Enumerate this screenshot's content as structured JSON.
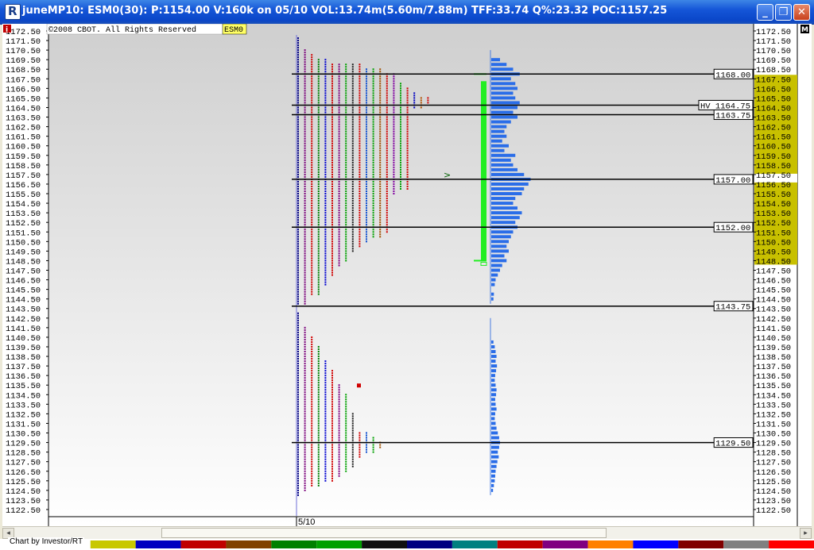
{
  "window": {
    "title": "juneMP10: ESM0(30): P:1154.00 V:160k on 05/10 VOL:13.74m(5.60m/7.88m)  TFF:33.74 Q%:23.32 POC:1157.25",
    "minimize_glyph": "_",
    "maximize_glyph": "❐",
    "close_glyph": "✕"
  },
  "copyright": "©2008 CBOT. All Rights Reserved",
  "symbol_tag": "ESM0",
  "info_icon": "i",
  "corner_label": "M",
  "date_label": "5/10",
  "credit": "Chart by Investor/RT",
  "chart_data": {
    "type": "market-profile",
    "price_min": 1122.5,
    "price_max": 1172.5,
    "tick_step": 1.0,
    "price_ticks": [
      "1172.50",
      "1171.50",
      "1170.50",
      "1169.50",
      "1168.50",
      "1167.50",
      "1166.50",
      "1165.50",
      "1164.50",
      "1163.50",
      "1162.50",
      "1161.50",
      "1160.50",
      "1159.50",
      "1158.50",
      "1157.50",
      "1156.50",
      "1155.50",
      "1154.50",
      "1153.50",
      "1152.50",
      "1151.50",
      "1150.50",
      "1149.50",
      "1148.50",
      "1147.50",
      "1146.50",
      "1145.50",
      "1144.50",
      "1143.50",
      "1142.50",
      "1141.50",
      "1140.50",
      "1139.50",
      "1138.50",
      "1137.50",
      "1136.50",
      "1135.50",
      "1134.50",
      "1133.50",
      "1132.50",
      "1131.50",
      "1130.50",
      "1129.50",
      "1128.50",
      "1127.50",
      "1126.50",
      "1125.50",
      "1124.50",
      "1123.50",
      "1122.50"
    ],
    "value_area": {
      "high": 1167.5,
      "low": 1148.5
    },
    "current_price": 1157.5,
    "levels": [
      {
        "price": 1168.0,
        "label": "1168.00"
      },
      {
        "price": 1164.75,
        "label": "HV 1164.75"
      },
      {
        "price": 1163.75,
        "label": "1163.75"
      },
      {
        "price": 1157.0,
        "label": "1157.00"
      },
      {
        "price": 1152.0,
        "label": "1152.00"
      },
      {
        "price": 1143.75,
        "label": "1143.75"
      },
      {
        "price": 1129.5,
        "label": "1129.50"
      }
    ],
    "upper_profile": {
      "columns": [
        {
          "top": 1171.75,
          "bottom": 1144.0
        },
        {
          "top": 1170.5,
          "bottom": 1144.0
        },
        {
          "top": 1170.0,
          "bottom": 1145.0
        },
        {
          "top": 1169.5,
          "bottom": 1145.0
        },
        {
          "top": 1169.5,
          "bottom": 1146.0
        },
        {
          "top": 1169.0,
          "bottom": 1147.0
        },
        {
          "top": 1169.0,
          "bottom": 1148.0
        },
        {
          "top": 1169.0,
          "bottom": 1148.5
        },
        {
          "top": 1169.0,
          "bottom": 1149.5
        },
        {
          "top": 1169.0,
          "bottom": 1150.0
        },
        {
          "top": 1168.5,
          "bottom": 1150.5
        },
        {
          "top": 1168.5,
          "bottom": 1151.0
        },
        {
          "top": 1168.5,
          "bottom": 1151.0
        },
        {
          "top": 1168.0,
          "bottom": 1151.5
        },
        {
          "top": 1168.0,
          "bottom": 1155.5
        },
        {
          "top": 1167.0,
          "bottom": 1156.0
        },
        {
          "top": 1166.5,
          "bottom": 1156.0
        },
        {
          "top": 1166.0,
          "bottom": 1164.5
        },
        {
          "top": 1165.5,
          "bottom": 1164.5
        },
        {
          "top": 1165.5,
          "bottom": 1165.0
        }
      ]
    },
    "lower_profile": {
      "columns": [
        {
          "top": 1143.0,
          "bottom": 1124.0
        },
        {
          "top": 1141.5,
          "bottom": 1124.5
        },
        {
          "top": 1140.5,
          "bottom": 1125.0
        },
        {
          "top": 1139.5,
          "bottom": 1125.0
        },
        {
          "top": 1138.0,
          "bottom": 1125.5
        },
        {
          "top": 1137.0,
          "bottom": 1125.5
        },
        {
          "top": 1135.5,
          "bottom": 1126.0
        },
        {
          "top": 1134.5,
          "bottom": 1126.5
        },
        {
          "top": 1132.5,
          "bottom": 1127.0
        },
        {
          "top": 1130.5,
          "bottom": 1128.0
        },
        {
          "top": 1130.5,
          "bottom": 1128.5
        },
        {
          "top": 1130.0,
          "bottom": 1128.5
        },
        {
          "top": 1129.5,
          "bottom": 1129.0
        }
      ]
    },
    "volume_histogram": {
      "upper": [
        {
          "price": 1169.5,
          "v": 0.2
        },
        {
          "price": 1169.0,
          "v": 0.35
        },
        {
          "price": 1168.5,
          "v": 0.5
        },
        {
          "price": 1168.0,
          "v": 0.65
        },
        {
          "price": 1167.5,
          "v": 0.45
        },
        {
          "price": 1167.0,
          "v": 0.55
        },
        {
          "price": 1166.5,
          "v": 0.6
        },
        {
          "price": 1166.0,
          "v": 0.5
        },
        {
          "price": 1165.5,
          "v": 0.55
        },
        {
          "price": 1165.0,
          "v": 0.65
        },
        {
          "price": 1164.5,
          "v": 0.6
        },
        {
          "price": 1164.0,
          "v": 0.5
        },
        {
          "price": 1163.5,
          "v": 0.6
        },
        {
          "price": 1163.0,
          "v": 0.45
        },
        {
          "price": 1162.5,
          "v": 0.35
        },
        {
          "price": 1162.0,
          "v": 0.3
        },
        {
          "price": 1161.5,
          "v": 0.35
        },
        {
          "price": 1161.0,
          "v": 0.25
        },
        {
          "price": 1160.5,
          "v": 0.4
        },
        {
          "price": 1160.0,
          "v": 0.3
        },
        {
          "price": 1159.5,
          "v": 0.55
        },
        {
          "price": 1159.0,
          "v": 0.45
        },
        {
          "price": 1158.5,
          "v": 0.5
        },
        {
          "price": 1158.0,
          "v": 0.6
        },
        {
          "price": 1157.5,
          "v": 0.75
        },
        {
          "price": 1157.0,
          "v": 0.9
        },
        {
          "price": 1156.5,
          "v": 0.85
        },
        {
          "price": 1156.0,
          "v": 0.75
        },
        {
          "price": 1155.5,
          "v": 0.7
        },
        {
          "price": 1155.0,
          "v": 0.55
        },
        {
          "price": 1154.5,
          "v": 0.5
        },
        {
          "price": 1154.0,
          "v": 0.6
        },
        {
          "price": 1153.5,
          "v": 0.7
        },
        {
          "price": 1153.0,
          "v": 0.65
        },
        {
          "price": 1152.5,
          "v": 0.55
        },
        {
          "price": 1152.0,
          "v": 0.6
        },
        {
          "price": 1151.5,
          "v": 0.5
        },
        {
          "price": 1151.0,
          "v": 0.45
        },
        {
          "price": 1150.5,
          "v": 0.4
        },
        {
          "price": 1150.0,
          "v": 0.35
        },
        {
          "price": 1149.5,
          "v": 0.4
        },
        {
          "price": 1149.0,
          "v": 0.3
        },
        {
          "price": 1148.5,
          "v": 0.35
        },
        {
          "price": 1148.0,
          "v": 0.25
        },
        {
          "price": 1147.5,
          "v": 0.2
        },
        {
          "price": 1147.0,
          "v": 0.15
        },
        {
          "price": 1146.5,
          "v": 0.1
        },
        {
          "price": 1146.0,
          "v": 0.08
        },
        {
          "price": 1145.0,
          "v": 0.06
        },
        {
          "price": 1144.5,
          "v": 0.05
        }
      ],
      "lower": [
        {
          "price": 1140.0,
          "v": 0.05
        },
        {
          "price": 1139.5,
          "v": 0.08
        },
        {
          "price": 1139.0,
          "v": 0.1
        },
        {
          "price": 1138.5,
          "v": 0.12
        },
        {
          "price": 1138.0,
          "v": 0.1
        },
        {
          "price": 1137.5,
          "v": 0.13
        },
        {
          "price": 1137.0,
          "v": 0.11
        },
        {
          "price": 1136.5,
          "v": 0.09
        },
        {
          "price": 1136.0,
          "v": 0.08
        },
        {
          "price": 1135.5,
          "v": 0.1
        },
        {
          "price": 1135.0,
          "v": 0.12
        },
        {
          "price": 1134.5,
          "v": 0.11
        },
        {
          "price": 1134.0,
          "v": 0.09
        },
        {
          "price": 1133.5,
          "v": 0.1
        },
        {
          "price": 1133.0,
          "v": 0.12
        },
        {
          "price": 1132.5,
          "v": 0.09
        },
        {
          "price": 1132.0,
          "v": 0.08
        },
        {
          "price": 1131.5,
          "v": 0.1
        },
        {
          "price": 1131.0,
          "v": 0.12
        },
        {
          "price": 1130.5,
          "v": 0.15
        },
        {
          "price": 1130.0,
          "v": 0.18
        },
        {
          "price": 1129.5,
          "v": 0.2
        },
        {
          "price": 1129.0,
          "v": 0.18
        },
        {
          "price": 1128.5,
          "v": 0.15
        },
        {
          "price": 1128.0,
          "v": 0.17
        },
        {
          "price": 1127.5,
          "v": 0.14
        },
        {
          "price": 1127.0,
          "v": 0.12
        },
        {
          "price": 1126.5,
          "v": 0.1
        },
        {
          "price": 1126.0,
          "v": 0.09
        },
        {
          "price": 1125.5,
          "v": 0.08
        },
        {
          "price": 1125.0,
          "v": 0.06
        },
        {
          "price": 1124.5,
          "v": 0.04
        }
      ]
    },
    "tpo_colors": [
      "#000080",
      "#7b007b",
      "#d00000",
      "#008000",
      "#0000d0",
      "#d00000",
      "#800080",
      "#00a000",
      "#202020",
      "#d00000",
      "#1050d0",
      "#00a000",
      "#a05000",
      "#d00000",
      "#8000a0",
      "#00a000",
      "#d00000",
      "#0000c0",
      "#b05000",
      "#d00000"
    ],
    "palette_strip": [
      "#c8c800",
      "#0000c0",
      "#c00000",
      "#804000",
      "#008000",
      "#00a000",
      "#101010",
      "#000080",
      "#008080",
      "#c00000",
      "#800080",
      "#ff8000",
      "#0000ff",
      "#800000",
      "#808080",
      "#ff0000"
    ]
  }
}
